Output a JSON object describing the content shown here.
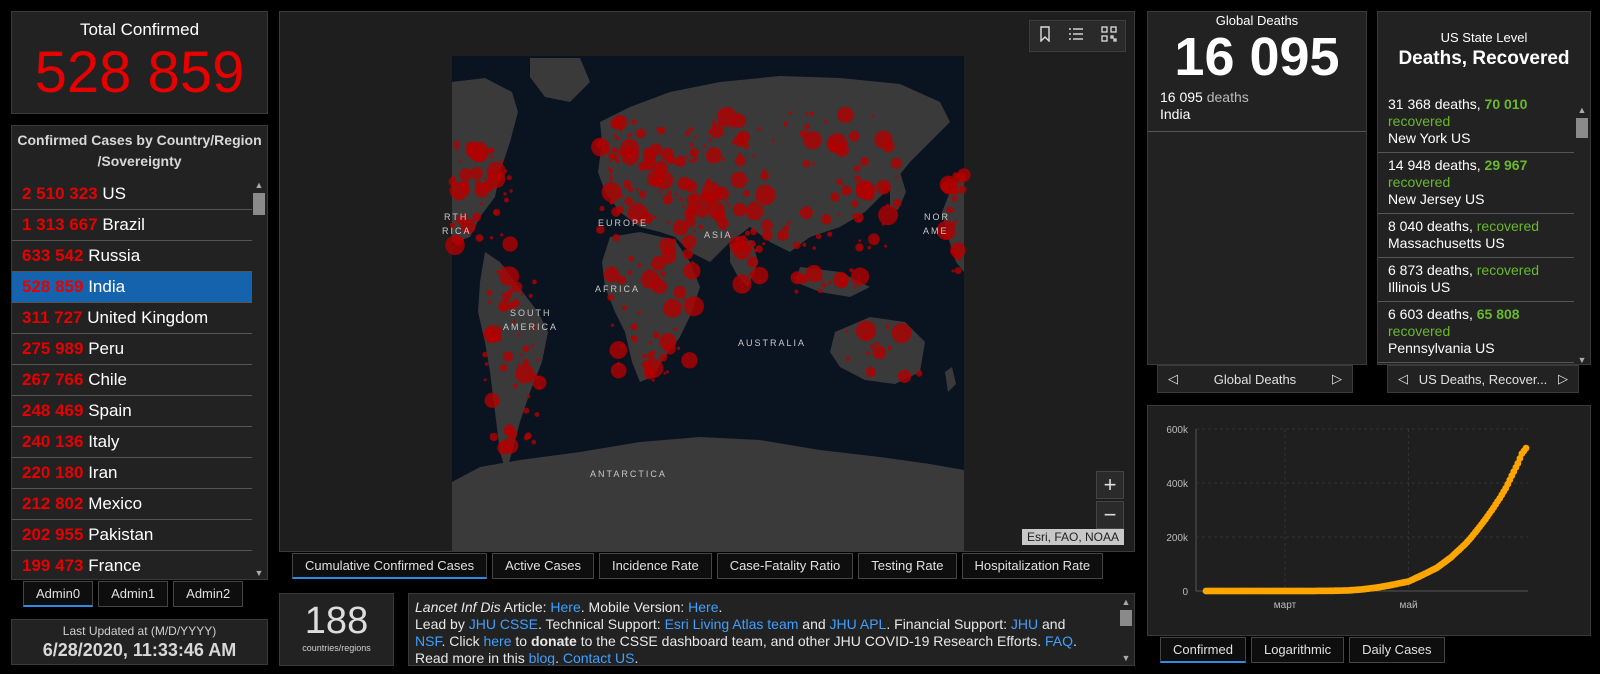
{
  "total": {
    "label": "Total Confirmed",
    "value": "528 859"
  },
  "country_list": {
    "header": "Confirmed Cases by Country/Region /Sovereignty",
    "rows": [
      {
        "value": "2 510 323",
        "country": "US"
      },
      {
        "value": "1 313 667",
        "country": "Brazil"
      },
      {
        "value": "633 542",
        "country": "Russia"
      },
      {
        "value": "528 859",
        "country": "India",
        "selected": true
      },
      {
        "value": "311 727",
        "country": "United Kingdom"
      },
      {
        "value": "275 989",
        "country": "Peru"
      },
      {
        "value": "267 766",
        "country": "Chile"
      },
      {
        "value": "248 469",
        "country": "Spain"
      },
      {
        "value": "240 136",
        "country": "Italy"
      },
      {
        "value": "220 180",
        "country": "Iran"
      },
      {
        "value": "212 802",
        "country": "Mexico"
      },
      {
        "value": "202 955",
        "country": "Pakistan"
      },
      {
        "value": "199 473",
        "country": "France"
      }
    ]
  },
  "admin_tabs": [
    "Admin0",
    "Admin1",
    "Admin2"
  ],
  "last_updated": {
    "label": "Last Updated at (M/D/YYYY)",
    "value": "6/28/2020, 11:33:46 AM"
  },
  "map": {
    "labels": [
      "EUROPE",
      "ASIA",
      "AFRICA",
      "SOUTH",
      "AMERICA",
      "AUSTRALIA",
      "ANTARCTICA",
      "RTH",
      "RICA",
      "NOR",
      "AME"
    ],
    "attribution": "Esri, FAO, NOAA",
    "zoom_in": "+",
    "zoom_out": "−",
    "tool_icons": [
      "bookmark-icon",
      "list-icon",
      "qr-grid-icon"
    ],
    "colors": {
      "ocean": "#0a1320",
      "land": "#3a3a3a",
      "bubble": "#b30000"
    }
  },
  "map_tabs": [
    "Cumulative Confirmed Cases",
    "Active Cases",
    "Incidence Rate",
    "Case-Fatality Ratio",
    "Testing Rate",
    "Hospitalization Rate"
  ],
  "count": {
    "value": "188",
    "label": "countries/regions"
  },
  "info": {
    "p1_italic": "Lancet Inf Dis",
    "p1_a": " Article: ",
    "here1": "Here",
    "p1_b": ". Mobile Version: ",
    "here2": "Here",
    "p1_c": ".",
    "p2_a": "Lead by ",
    "jhu_csse": "JHU CSSE",
    "p2_b": ". Technical Support: ",
    "esri": "Esri Living Atlas team",
    "p2_c": " and ",
    "jhu_apl": "JHU APL",
    "p2_d": ". Financial Support: ",
    "jhu": "JHU",
    "p2_e": " and",
    "nsf": "NSF",
    "p2_f": ". Click ",
    "here3": "here",
    "p2_g": " to ",
    "donate": "donate",
    "p2_h": " to the CSSE dashboard team, and other JHU COVID-19 Research Efforts. ",
    "faq": "FAQ",
    "p2_i": ". Read more in this ",
    "blog": "blog",
    "p2_j": ". ",
    "contact": "Contact US",
    "p2_k": "."
  },
  "global_deaths": {
    "title": "Global Deaths",
    "value": "16 095",
    "detail_value": "16 095",
    "detail_unit": "deaths",
    "detail_place": "India",
    "pager_label": "Global Deaths"
  },
  "us_state": {
    "title1": "US State Level",
    "title2": "Deaths, Recovered",
    "rows": [
      {
        "deaths": "31 368",
        "recovered": "70 010",
        "place": "New York US"
      },
      {
        "deaths": "14 948",
        "recovered": "29 967",
        "place": "New Jersey US"
      },
      {
        "deaths": "8 040",
        "recovered": "",
        "place": "Massachusetts US"
      },
      {
        "deaths": "6 873",
        "recovered": "",
        "place": "Illinois US"
      },
      {
        "deaths": "6 603",
        "recovered": "65 808",
        "place": "Pennsylvania US"
      }
    ],
    "deaths_word": "deaths,",
    "recovered_word": "recovered",
    "pager_label": "US Deaths, Recover..."
  },
  "chart_data": {
    "type": "scatter",
    "title": "",
    "xlabel": "",
    "ylabel": "",
    "x_tick_labels": [
      "март",
      "май"
    ],
    "y_tick_labels": [
      "0",
      "200k",
      "400k",
      "600k"
    ],
    "ylim": [
      0,
      600000
    ],
    "series": [
      {
        "color": "#ffa500",
        "x": [
          "01-22",
          "02-01",
          "02-15",
          "03-01",
          "03-15",
          "03-22",
          "04-01",
          "04-08",
          "04-15",
          "04-22",
          "05-01",
          "05-08",
          "05-15",
          "05-22",
          "05-29",
          "06-01",
          "06-05",
          "06-08",
          "06-12",
          "06-15",
          "06-18",
          "06-21",
          "06-24",
          "06-26",
          "06-28"
        ],
        "values": [
          0,
          1,
          3,
          3,
          107,
          396,
          1998,
          5916,
          12380,
          21393,
          35365,
          59662,
          85940,
          124794,
          173763,
          198706,
          236657,
          265928,
          308993,
          343091,
          380532,
          426910,
          473105,
          508953,
          528859
        ]
      }
    ],
    "grid": true
  },
  "chart_tabs": [
    "Confirmed",
    "Logarithmic",
    "Daily Cases"
  ]
}
